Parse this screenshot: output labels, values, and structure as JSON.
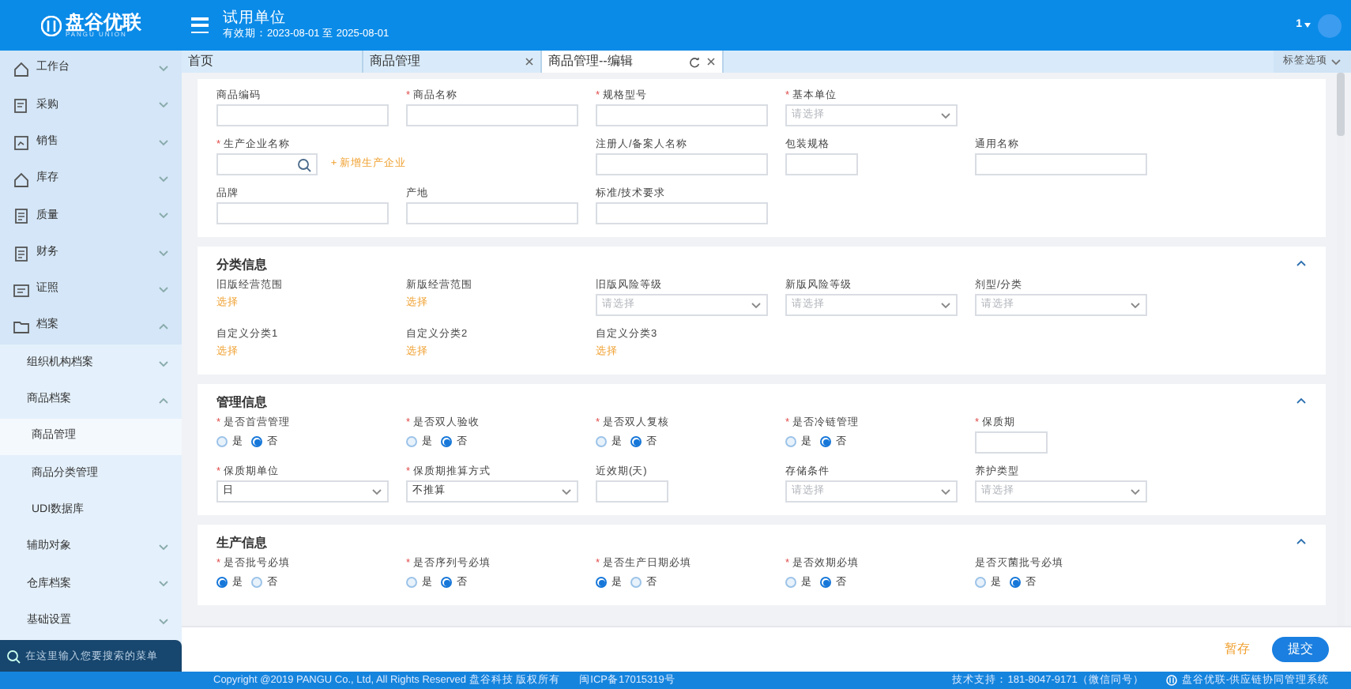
{
  "header": {
    "brand": "盘谷优联",
    "brand_sub": "PANGU UNION",
    "org": "试用单位",
    "validity": "有效期：2023-08-01 至 2025-08-01",
    "user": "1"
  },
  "sidebar": {
    "items": [
      {
        "kind": "module",
        "label": "工作台",
        "expanded": false
      },
      {
        "kind": "module",
        "label": "采购",
        "expanded": false
      },
      {
        "kind": "module",
        "label": "销售",
        "expanded": false
      },
      {
        "kind": "module",
        "label": "库存",
        "expanded": false
      },
      {
        "kind": "module",
        "label": "质量",
        "expanded": false
      },
      {
        "kind": "module",
        "label": "财务",
        "expanded": false
      },
      {
        "kind": "module",
        "label": "证照",
        "expanded": false
      },
      {
        "kind": "module",
        "label": "档案",
        "expanded": true,
        "children": [
          {
            "label": "组织机构档案",
            "expanded": false
          },
          {
            "label": "商品档案",
            "expanded": true,
            "children": [
              {
                "label": "商品管理",
                "selected": true
              },
              {
                "label": "商品分类管理",
                "selected": false
              },
              {
                "label": "UDI数据库",
                "selected": false
              }
            ]
          }
        ]
      },
      {
        "kind": "plain",
        "label": "辅助对象",
        "expanded": false
      },
      {
        "kind": "plain",
        "label": "仓库档案",
        "expanded": false
      },
      {
        "kind": "plain",
        "label": "基础设置",
        "expanded": false
      }
    ],
    "search_placeholder": "在这里输入您要搜索的菜单"
  },
  "tabs": [
    {
      "label": "首页",
      "selected": false,
      "closable": false,
      "refresh": false
    },
    {
      "label": "商品管理",
      "selected": false,
      "closable": true,
      "refresh": false
    },
    {
      "label": "商品管理--编辑",
      "selected": true,
      "closable": true,
      "refresh": true
    }
  ],
  "tab_options": "标签选项",
  "sections": [
    {
      "rows": [
        [
          {
            "kind": "input",
            "label": "商品编码"
          },
          {
            "kind": "input",
            "label": "商品名称",
            "mark": "*"
          },
          {
            "kind": "input",
            "label": "规格型号",
            "mark": "*"
          },
          {
            "kind": "select",
            "label": "基本单位",
            "mark": "*",
            "placeholder": "请选择"
          }
        ],
        [
          {
            "kind": "search",
            "label": "生产企业名称",
            "mark": "*",
            "link": "+ 新增生产企业"
          },
          "",
          {
            "kind": "input",
            "label": "注册人/备案人名称"
          },
          {
            "kind": "short_input",
            "label": "包装规格"
          },
          {
            "kind": "input",
            "label": "通用名称"
          }
        ],
        [
          {
            "kind": "input",
            "label": "品牌"
          },
          {
            "kind": "input",
            "label": "产地"
          },
          {
            "kind": "input",
            "label": "标准/技术要求"
          }
        ]
      ]
    },
    {
      "title": "分类信息",
      "expanded": true,
      "rows": [
        [
          {
            "kind": "pick",
            "label": "旧版经营范围",
            "link": "选择"
          },
          {
            "kind": "pick",
            "label": "新版经营范围",
            "link": "选择"
          },
          {
            "kind": "select",
            "label": "旧版风险等级",
            "placeholder": "请选择"
          },
          {
            "kind": "select",
            "label": "新版风险等级",
            "placeholder": "请选择"
          },
          {
            "kind": "select",
            "label": "剂型/分类",
            "placeholder": "请选择"
          }
        ],
        [
          {
            "kind": "pick",
            "label": "自定义分类1",
            "link": "选择"
          },
          {
            "kind": "pick",
            "label": "自定义分类2",
            "link": "选择"
          },
          {
            "kind": "pick",
            "label": "自定义分类3",
            "link": "选择"
          }
        ]
      ]
    },
    {
      "title": "管理信息",
      "expanded": true,
      "rows": [
        [
          {
            "kind": "radio",
            "label": "是否首营管理",
            "mark": "*",
            "options": [
              {
                "label": "是",
                "selected": false
              },
              {
                "label": "否",
                "selected": true
              }
            ]
          },
          {
            "kind": "radio",
            "label": "是否双人验收",
            "mark": "*",
            "options": [
              {
                "label": "是",
                "selected": false
              },
              {
                "label": "否",
                "selected": true
              }
            ]
          },
          {
            "kind": "radio",
            "label": "是否双人复核",
            "mark": "*",
            "options": [
              {
                "label": "是",
                "selected": false
              },
              {
                "label": "否",
                "selected": true
              }
            ]
          },
          {
            "kind": "radio",
            "label": "是否冷链管理",
            "mark": "*",
            "options": [
              {
                "label": "是",
                "selected": false
              },
              {
                "label": "否",
                "selected": true
              }
            ]
          },
          {
            "kind": "short_input",
            "label": "保质期",
            "mark": "*"
          }
        ],
        [
          {
            "kind": "select",
            "label": "保质期单位",
            "mark": "*",
            "value": "日"
          },
          {
            "kind": "select",
            "label": "保质期推算方式",
            "mark": "*",
            "value": "不推算"
          },
          {
            "kind": "short_input",
            "label": "近效期(天)"
          },
          {
            "kind": "select",
            "label": "存储条件",
            "placeholder": "请选择"
          },
          {
            "kind": "select",
            "label": "养护类型",
            "placeholder": "请选择"
          }
        ]
      ]
    },
    {
      "title": "生产信息",
      "expanded": true,
      "rows": [
        [
          {
            "kind": "radio",
            "label": "是否批号必填",
            "mark": "*",
            "options": [
              {
                "label": "是",
                "selected": true
              },
              {
                "label": "否",
                "selected": false
              }
            ]
          },
          {
            "kind": "radio",
            "label": "是否序列号必填",
            "mark": "*",
            "options": [
              {
                "label": "是",
                "selected": false
              },
              {
                "label": "否",
                "selected": true
              }
            ]
          },
          {
            "kind": "radio",
            "label": "是否生产日期必填",
            "mark": "*",
            "options": [
              {
                "label": "是",
                "selected": true
              },
              {
                "label": "否",
                "selected": false
              }
            ]
          },
          {
            "kind": "radio",
            "label": "是否效期必填",
            "mark": "*",
            "options": [
              {
                "label": "是",
                "selected": false
              },
              {
                "label": "否",
                "selected": true
              }
            ]
          },
          {
            "kind": "radio",
            "label": "是否灭菌批号必填",
            "options": [
              {
                "label": "是",
                "selected": false
              },
              {
                "label": "否",
                "selected": true
              }
            ]
          }
        ]
      ]
    }
  ],
  "actions": [
    {
      "kind": "secondary",
      "label": "暂存"
    },
    {
      "kind": "primary",
      "label": "提交"
    }
  ],
  "footer": {
    "copyright": "Copyright @2019 PANGU Co., Ltd, All Rights Reserved 盘谷科技 版权所有",
    "icp": "闽ICP备17015319号",
    "support": "技术支持：181-8047-9171（微信同号）",
    "system": "盘谷优联-供应链协同管理系统"
  }
}
